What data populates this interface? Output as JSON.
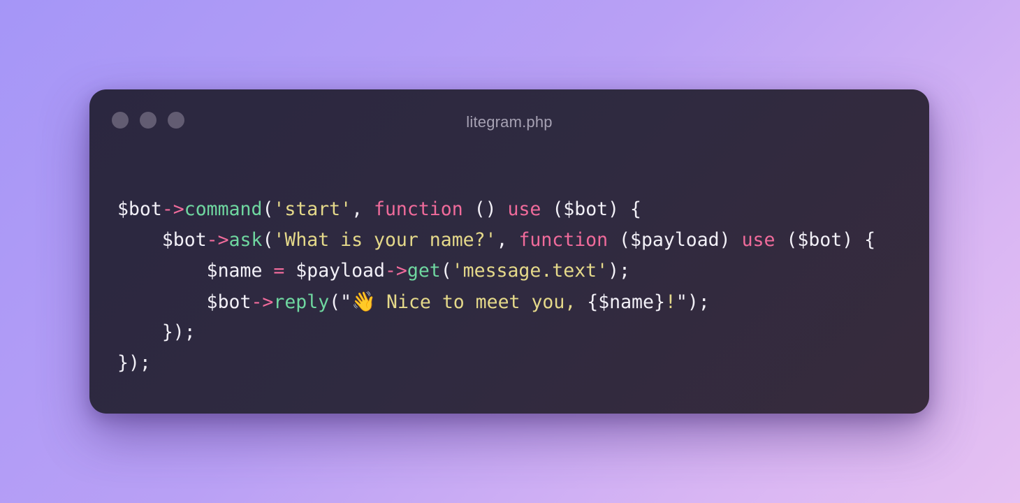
{
  "window": {
    "title": "litegram.php",
    "controls": [
      "window-dot",
      "window-dot",
      "window-dot"
    ]
  },
  "colors": {
    "background_start": "#a596f7",
    "background_end": "#e6c1f2",
    "window_bg": "#2d2840",
    "dot": "#625c72",
    "title": "#a6a1b3",
    "default_text": "#f2f0f7",
    "operator_keyword": "#f06b9b",
    "function_name": "#6fd7a0",
    "string": "#e5d98a"
  },
  "code": {
    "language": "php",
    "lines": [
      [
        {
          "t": "$bot",
          "c": "var"
        },
        {
          "t": "->",
          "c": "op"
        },
        {
          "t": "command",
          "c": "fn"
        },
        {
          "t": "(",
          "c": "punc"
        },
        {
          "t": "'start'",
          "c": "str"
        },
        {
          "t": ", ",
          "c": "punc"
        },
        {
          "t": "function",
          "c": "kw"
        },
        {
          "t": " () ",
          "c": "punc"
        },
        {
          "t": "use",
          "c": "kw"
        },
        {
          "t": " (",
          "c": "punc"
        },
        {
          "t": "$bot",
          "c": "var"
        },
        {
          "t": ") {",
          "c": "punc"
        }
      ],
      [
        {
          "t": "    ",
          "c": "punc"
        },
        {
          "t": "$bot",
          "c": "var"
        },
        {
          "t": "->",
          "c": "op"
        },
        {
          "t": "ask",
          "c": "fn"
        },
        {
          "t": "(",
          "c": "punc"
        },
        {
          "t": "'What is your name?'",
          "c": "str"
        },
        {
          "t": ", ",
          "c": "punc"
        },
        {
          "t": "function",
          "c": "kw"
        },
        {
          "t": " (",
          "c": "punc"
        },
        {
          "t": "$payload",
          "c": "var"
        },
        {
          "t": ") ",
          "c": "punc"
        },
        {
          "t": "use",
          "c": "kw"
        },
        {
          "t": " (",
          "c": "punc"
        },
        {
          "t": "$bot",
          "c": "var"
        },
        {
          "t": ") {",
          "c": "punc"
        }
      ],
      [
        {
          "t": "        ",
          "c": "punc"
        },
        {
          "t": "$name",
          "c": "var"
        },
        {
          "t": " = ",
          "c": "op"
        },
        {
          "t": "$payload",
          "c": "var"
        },
        {
          "t": "->",
          "c": "op"
        },
        {
          "t": "get",
          "c": "fn"
        },
        {
          "t": "(",
          "c": "punc"
        },
        {
          "t": "'message.text'",
          "c": "str"
        },
        {
          "t": ");",
          "c": "punc"
        }
      ],
      [
        {
          "t": "        ",
          "c": "punc"
        },
        {
          "t": "$bot",
          "c": "var"
        },
        {
          "t": "->",
          "c": "op"
        },
        {
          "t": "reply",
          "c": "fn"
        },
        {
          "t": "(\"",
          "c": "punc"
        },
        {
          "t": "👋",
          "c": "emoji"
        },
        {
          "t": " Nice to meet you, ",
          "c": "str"
        },
        {
          "t": "{$name}",
          "c": "var"
        },
        {
          "t": "!",
          "c": "str"
        },
        {
          "t": "\");",
          "c": "punc"
        }
      ],
      [
        {
          "t": "    ",
          "c": "punc"
        },
        {
          "t": "});",
          "c": "punc"
        }
      ],
      [
        {
          "t": "});",
          "c": "punc"
        }
      ]
    ]
  }
}
